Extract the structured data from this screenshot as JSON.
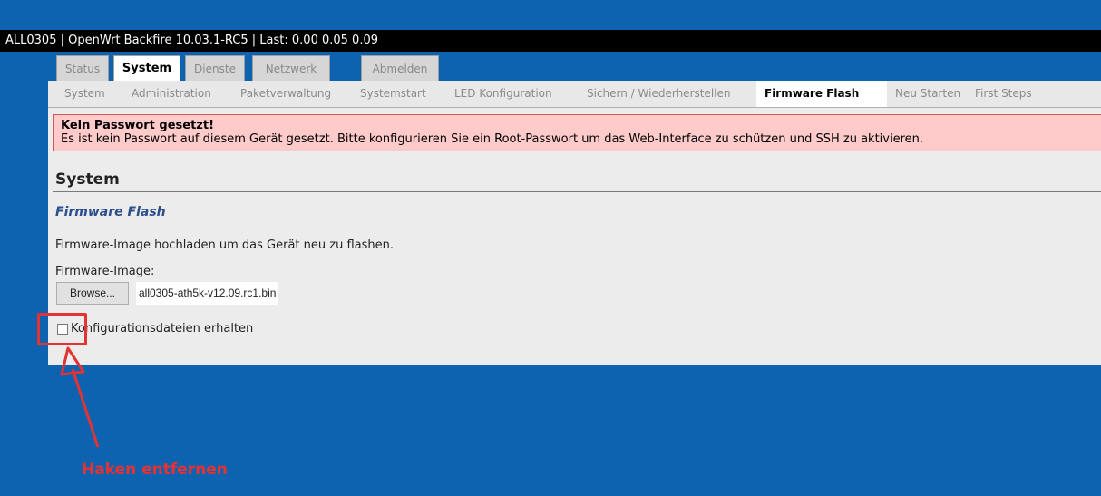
{
  "window": {
    "title": "ALL0305 | OpenWrt Backfire 10.03.1-RC5 | Last: 0.00 0.05 0.09"
  },
  "main_tabs": [
    {
      "label": "Status",
      "active": false
    },
    {
      "label": "System",
      "active": true
    },
    {
      "label": "Dienste",
      "active": false
    },
    {
      "label": "Netzwerk",
      "active": false
    },
    {
      "label": "Abmelden",
      "active": false
    }
  ],
  "sub_tabs": [
    {
      "label": "System",
      "active": false
    },
    {
      "label": "Administration",
      "active": false
    },
    {
      "label": "Paketverwaltung",
      "active": false
    },
    {
      "label": "Systemstart",
      "active": false
    },
    {
      "label": "LED Konfiguration",
      "active": false
    },
    {
      "label": "Sichern / Wiederherstellen",
      "active": false
    },
    {
      "label": "Firmware Flash",
      "active": true
    },
    {
      "label": "Neu Starten",
      "active": false
    },
    {
      "label": "First Steps",
      "active": false
    }
  ],
  "warning": {
    "title": "Kein Passwort gesetzt!",
    "body": "Es ist kein Passwort auf diesem Gerät gesetzt. Bitte konfigurieren Sie ein Root-Passwort um das Web-Interface zu schützen und SSH zu aktivieren."
  },
  "section": {
    "title": "System",
    "subtitle": "Firmware Flash",
    "description": "Firmware-Image hochladen um das Gerät neu zu flashen."
  },
  "upload": {
    "label": "Firmware-Image:",
    "browse_label": "Browse...",
    "file_name": "all0305-ath5k-v12.09.rc1.bin"
  },
  "keep_config": {
    "label": "Konfigurationsdateien erhalten",
    "checked": false
  },
  "annotation": {
    "text": "Haken entfernen",
    "color": "#e53232"
  },
  "colors": {
    "background": "#0d63b0",
    "titlebar": "#000000",
    "warning_bg": "#ffcaca",
    "subtitle": "#2a4f8c"
  }
}
